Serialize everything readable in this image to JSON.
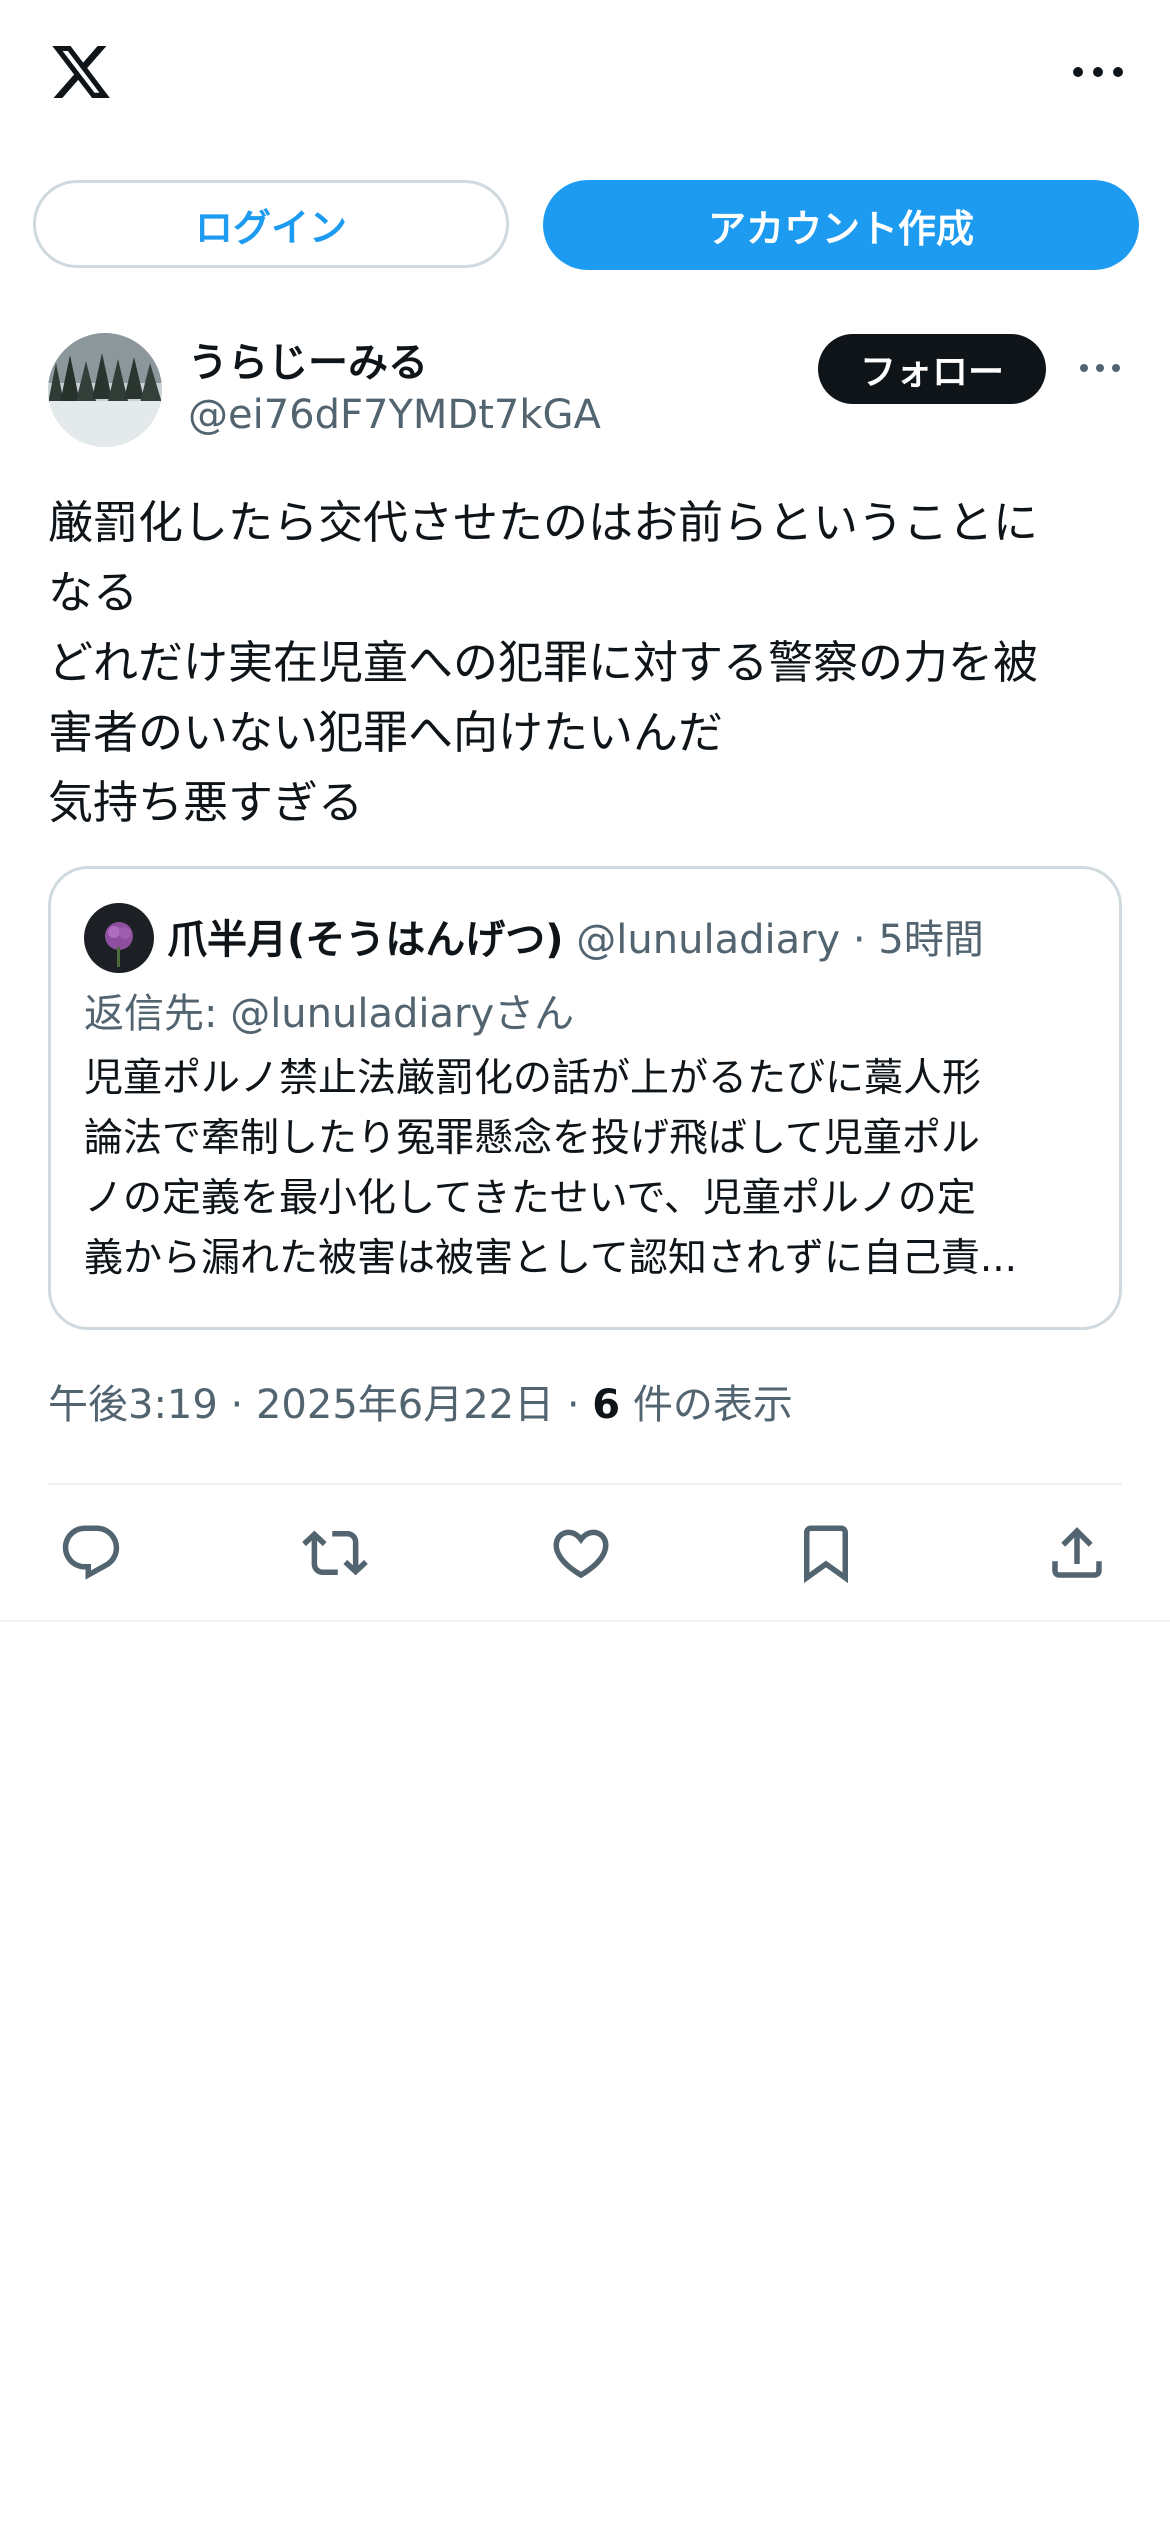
{
  "header": {
    "logo_icon": "x-logo-icon",
    "more_icon": "more-horizontal-icon"
  },
  "auth": {
    "login_label": "ログイン",
    "signup_label": "アカウント作成",
    "accent_color": "#1d9bf0"
  },
  "post": {
    "author_name": "うらじーみる",
    "author_handle": "@ei76dF7YMDt7kGA",
    "follow_label": "フォロー",
    "text_lines": [
      "厳罰化したら交代させたのはお前らということに",
      "なる",
      "どれだけ実在児童への犯罪に対する警察の力を被",
      "害者のいない犯罪へ向けたいんだ",
      "気持ち悪すぎる"
    ],
    "quote": {
      "name": "爪半月(そうはんげつ)",
      "handle": "@lunuladiary",
      "separator": " · ",
      "time": "5時間",
      "reply_to": "返信先: @lunuladiaryさん",
      "text_lines": [
        "児童ポルノ禁止法厳罰化の話が上がるたびに藁人形",
        "論法で牽制したり冤罪懸念を投げ飛ばして児童ポル",
        "ノの定義を最小化してきたせいで、児童ポルノの定",
        "義から漏れた被害は被害として認知されずに自己責..."
      ]
    },
    "timestamp": "午後3:19 · 2025年6月22日 · ",
    "views_count": "6",
    "views_label": " 件の表示"
  },
  "actions": [
    {
      "name": "reply-icon"
    },
    {
      "name": "retweet-icon"
    },
    {
      "name": "like-icon"
    },
    {
      "name": "bookmark-icon"
    },
    {
      "name": "share-icon"
    }
  ]
}
